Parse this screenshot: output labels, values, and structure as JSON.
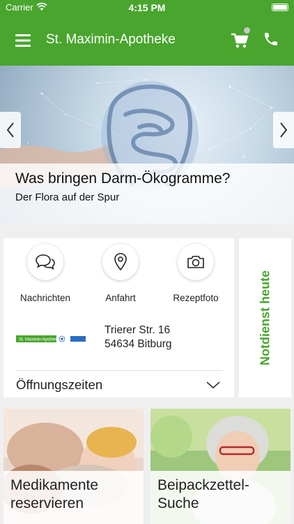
{
  "status_bar": {
    "carrier": "Carrier",
    "time": "4:15 PM"
  },
  "app_bar": {
    "title": "St. Maximin-Apotheke",
    "icons": [
      "menu-icon",
      "cart-icon",
      "phone-icon"
    ]
  },
  "hero": {
    "title": "Was bringen Darm-Ökogramme?",
    "subtitle": "Der Flora auf der Spur"
  },
  "actions": [
    {
      "label": "Nachrichten",
      "icon": "chat-icon"
    },
    {
      "label": "Anfahrt",
      "icon": "location-pin-icon"
    },
    {
      "label": "Rezeptfoto",
      "icon": "camera-icon"
    }
  ],
  "pharmacy": {
    "logo_text": "St. Maximin-Apotheke",
    "street": "Trierer Str. 16",
    "city": "54634 Bitburg"
  },
  "hours": {
    "label": "Öffnungszeiten"
  },
  "emergency": {
    "label": "Notdienst heute"
  },
  "tiles": [
    {
      "line1": "Medikamente",
      "line2": "reservieren"
    },
    {
      "line1": "Beipackzettel-",
      "line2": "Suche"
    }
  ],
  "colors": {
    "brand_green": "#4aa52e",
    "card": "#ffffff",
    "background": "#efefef"
  }
}
